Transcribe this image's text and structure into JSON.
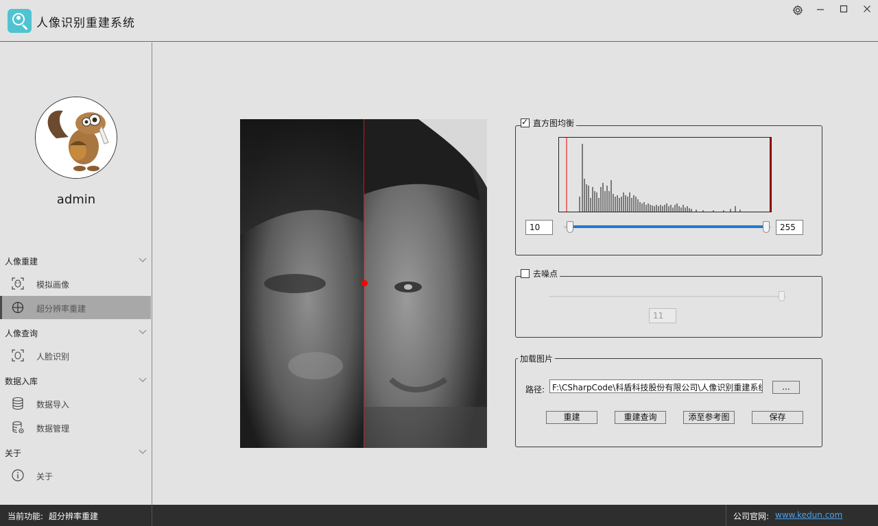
{
  "app": {
    "title": "人像识别重建系统"
  },
  "window_controls": {
    "settings_icon": "gear-icon",
    "minimize": "—",
    "maximize": "□",
    "close": "✕"
  },
  "user": {
    "name": "admin"
  },
  "sidebar": {
    "groups": [
      {
        "label": "人像重建",
        "items": [
          {
            "label": "模拟画像",
            "icon": "face-scan-icon"
          },
          {
            "label": "超分辨率重建",
            "icon": "globe-icon",
            "active": true
          }
        ]
      },
      {
        "label": "人像查询",
        "items": [
          {
            "label": "人脸识别",
            "icon": "face-scan-icon"
          }
        ]
      },
      {
        "label": "数据入库",
        "items": [
          {
            "label": "数据导入",
            "icon": "database-icon"
          },
          {
            "label": "数据管理",
            "icon": "database-gear-icon"
          }
        ]
      },
      {
        "label": "关于",
        "items": [
          {
            "label": "关于",
            "icon": "info-icon"
          }
        ]
      }
    ]
  },
  "histogram": {
    "label": "直方图均衡",
    "checked": true,
    "min_value": "10",
    "max_value": "255",
    "range_low_fraction": 0.04,
    "range_high_fraction": 1.0
  },
  "denoise": {
    "label": "去噪点",
    "checked": false,
    "value": "11",
    "slider_fraction": 1.0
  },
  "load_image": {
    "label": "加载图片",
    "path_label": "路径:",
    "path_value": "F:\\CSharpCode\\科盾科技股份有限公司\\人像识别重建系统",
    "browse_label": "...",
    "buttons": {
      "rebuild": "重建",
      "rebuild_query": "重建查询",
      "add_reference": "添至参考图",
      "save": "保存"
    }
  },
  "status": {
    "current_label": "当前功能:",
    "current_value": "超分辨率重建",
    "website_label": "公司官网:",
    "website_link": "www.kedun.com"
  },
  "colors": {
    "accent_blue": "#1e7bd0",
    "split_line": "#e01010",
    "logo": "#4fc3d2"
  }
}
